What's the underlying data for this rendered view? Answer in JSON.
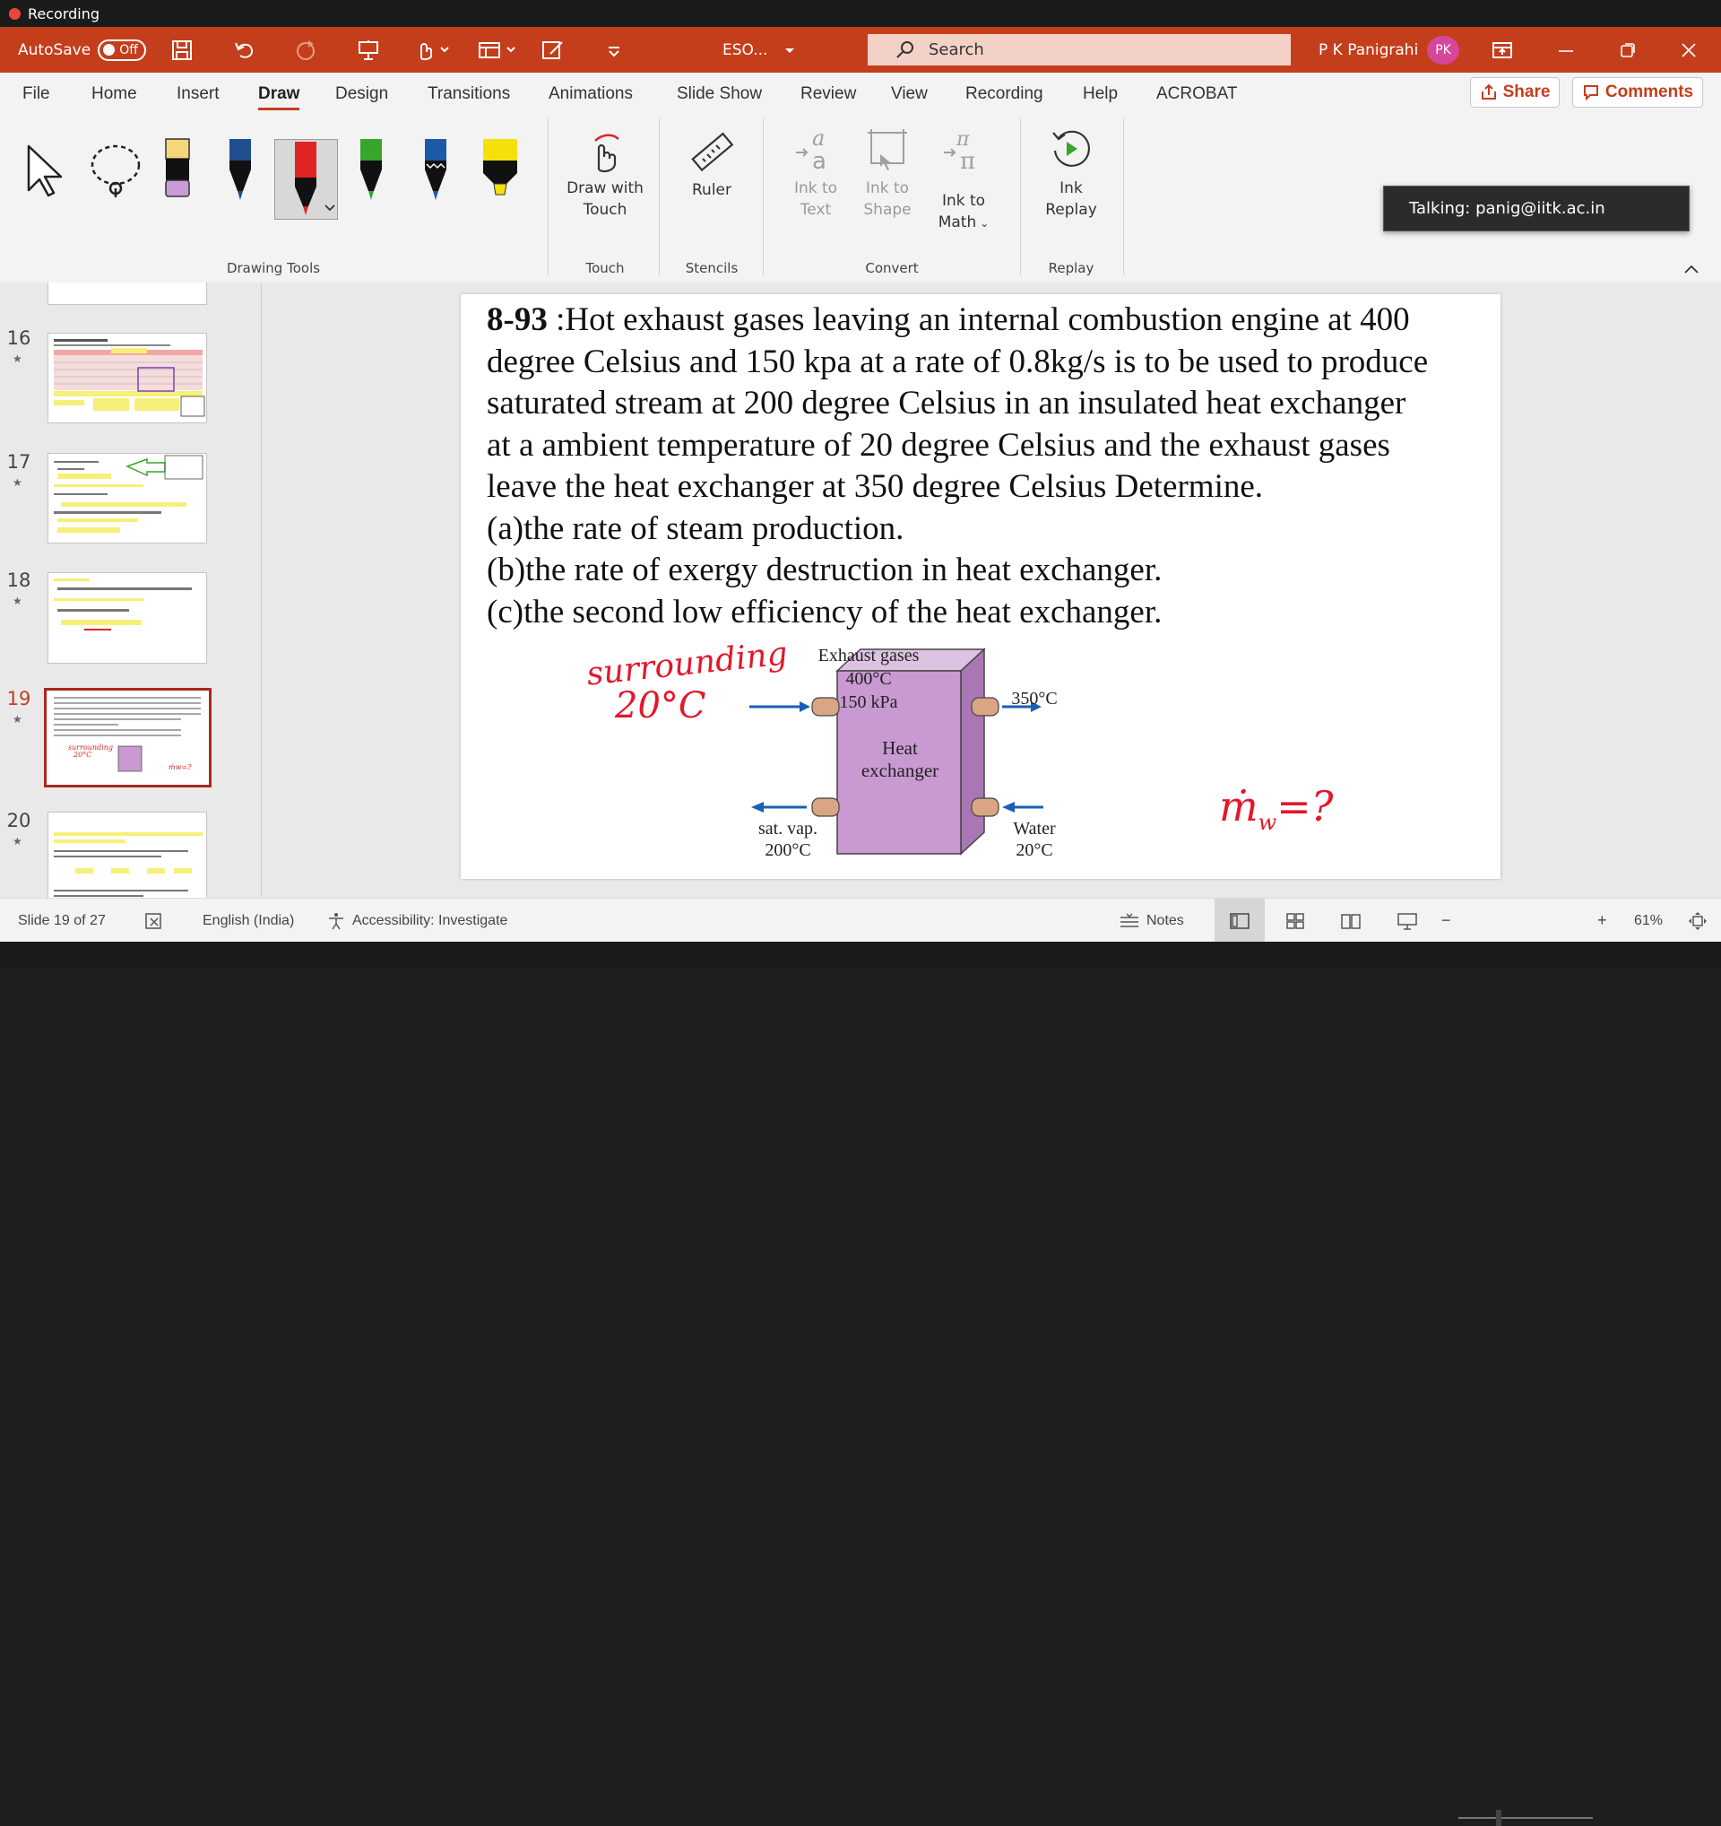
{
  "recording": {
    "label": "Recording"
  },
  "titlebar": {
    "autosave_label": "AutoSave",
    "autosave_state": "Off",
    "file_name": "ESO...",
    "search_placeholder": "Search",
    "user_name": "P K Panigrahi",
    "user_initials": "PK"
  },
  "menu": {
    "tabs": [
      "File",
      "Home",
      "Insert",
      "Draw",
      "Design",
      "Transitions",
      "Animations",
      "Slide Show",
      "Review",
      "View",
      "Recording",
      "Help",
      "ACROBAT"
    ],
    "active": "Draw",
    "share_label": "Share",
    "comments_label": "Comments"
  },
  "ribbon": {
    "groups": {
      "drawing_tools": "Drawing Tools",
      "touch": "Touch",
      "stencils": "Stencils",
      "convert": "Convert",
      "replay": "Replay"
    },
    "draw_with_touch": [
      "Draw with",
      "Touch"
    ],
    "ruler": "Ruler",
    "ink_to_text": [
      "Ink to",
      "Text"
    ],
    "ink_to_shape": [
      "Ink to",
      "Shape"
    ],
    "ink_to_math": [
      "Ink to",
      "Math"
    ],
    "ink_replay": [
      "Ink",
      "Replay"
    ],
    "pen_colors": [
      "#f5d67a",
      "#1f4f8f",
      "#e02424",
      "#37a62a",
      "#1c5aa8",
      "#f4e10c"
    ]
  },
  "tooltip": {
    "text": "Talking: panig@iitk.ac.in"
  },
  "thumbnails": [
    {
      "num": "16",
      "selected": false
    },
    {
      "num": "17",
      "selected": false
    },
    {
      "num": "18",
      "selected": false
    },
    {
      "num": "19",
      "selected": true
    },
    {
      "num": "20",
      "selected": false
    }
  ],
  "slide": {
    "problem_number": "8-93",
    "lines": [
      " :Hot exhaust gases leaving an internal combustion engine at 400",
      "degree Celsius and 150 kpa at a rate of 0.8kg/s is to be used to produce",
      "saturated stream at 200 degree Celsius in an insulated heat exchanger",
      "at a ambient temperature of 20 degree Celsius and the exhaust gases",
      "leave the heat exchanger at 350 degree Celsius Determine.",
      "(a)the rate of steam production.",
      "(b)the rate of exergy destruction in heat exchanger.",
      "(c)the second low efficiency of the heat exchanger."
    ],
    "diagram": {
      "exhaust_label": "Exhaust gases",
      "exhaust_temp": "400°C",
      "exhaust_pressure": "150 kPa",
      "outlet_temp": "350°C",
      "box_line1": "Heat",
      "box_line2": "exchanger",
      "satvap_label": "sat. vap.",
      "satvap_temp": "200°C",
      "water_label": "Water",
      "water_temp": "20°C",
      "box_color": "#c99ad1"
    },
    "ink": {
      "surrounding": "surrounding",
      "temp": "20°C",
      "mass_flow": "ṁ",
      "subscript": "w",
      "equals": "=?"
    }
  },
  "status": {
    "slide_info": "Slide 19 of 27",
    "language": "English (India)",
    "accessibility": "Accessibility: Investigate",
    "notes": "Notes",
    "zoom": "61%"
  }
}
